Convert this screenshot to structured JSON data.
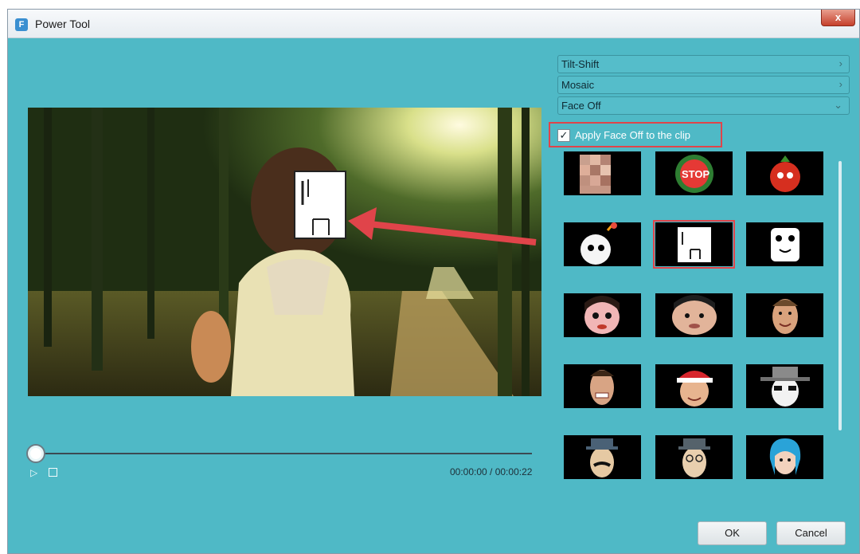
{
  "window": {
    "title": "Power Tool",
    "app_icon_letter": "F",
    "close_symbol": "x"
  },
  "player": {
    "time_display": "00:00:00 / 00:00:22",
    "progress": 0
  },
  "effects_panel": {
    "sections": [
      {
        "label": "Tilt-Shift",
        "state": "collapsed"
      },
      {
        "label": "Mosaic",
        "state": "collapsed"
      },
      {
        "label": "Face Off",
        "state": "expanded"
      }
    ],
    "apply_label": "Apply Face Off to the clip",
    "apply_checked": true,
    "masks": [
      "mosaic-blur-mask",
      "stop-sign-mask",
      "tomato-mask",
      "bomb-mask",
      "paper-bag-mask",
      "ghost-mask",
      "doll-face-mask",
      "chubby-face-mask",
      "smiling-man-mask",
      "grinning-man-mask",
      "santa-hat-mask",
      "fedora-sunglasses-mask",
      "mustache-man-mask",
      "glasses-man-mask",
      "blue-hair-girl-mask"
    ],
    "selected_mask": "paper-bag-mask"
  },
  "buttons": {
    "ok": "OK",
    "cancel": "Cancel"
  },
  "colors": {
    "dialog_bg": "#4fb9c6",
    "highlight": "#e0444a"
  }
}
